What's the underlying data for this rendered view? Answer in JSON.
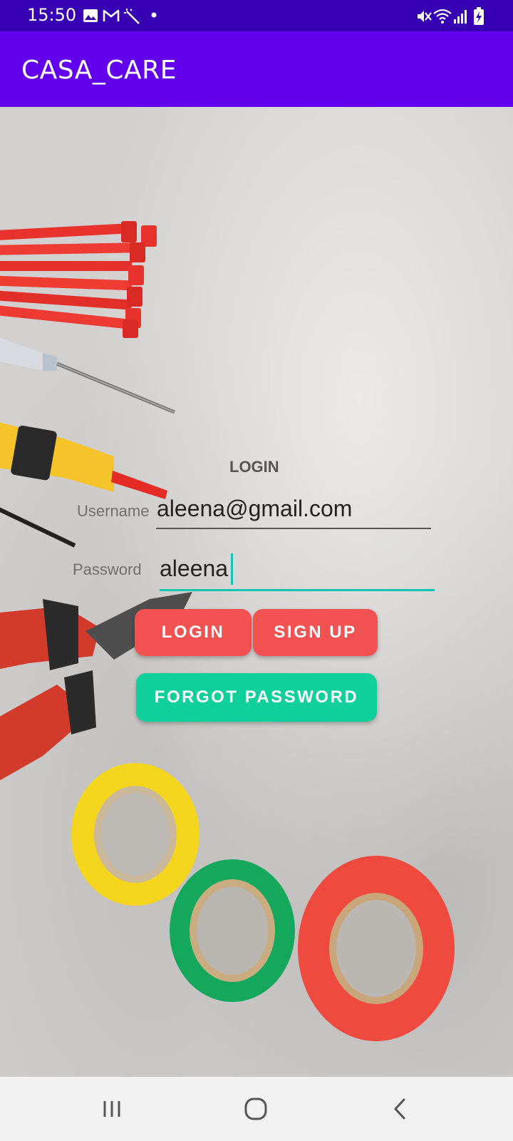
{
  "status_bar": {
    "time": "15:50",
    "icons": [
      "image-icon",
      "gmail-icon",
      "magic-wand-icon",
      "dot-icon",
      "mute-icon",
      "wifi-icon",
      "signal-icon",
      "battery-charging-icon"
    ]
  },
  "app_bar": {
    "title": "CASA_CARE"
  },
  "login_form": {
    "heading": "LOGIN",
    "username_label": "Username",
    "username_value": "aleena@gmail.com",
    "password_label": "Password",
    "password_value": "aleena",
    "login_button": "LOGIN",
    "signup_button": "SIGN UP",
    "forgot_button": "FORGOT PASSWORD"
  },
  "colors": {
    "status_bar": "#3700b3",
    "app_bar": "#6200ee",
    "primary_button": "#f25252",
    "secondary_button": "#0fcf9b",
    "focus_accent": "#12c4b5"
  },
  "nav_bar": {
    "icons": [
      "recent-apps-icon",
      "home-icon",
      "back-icon"
    ]
  }
}
